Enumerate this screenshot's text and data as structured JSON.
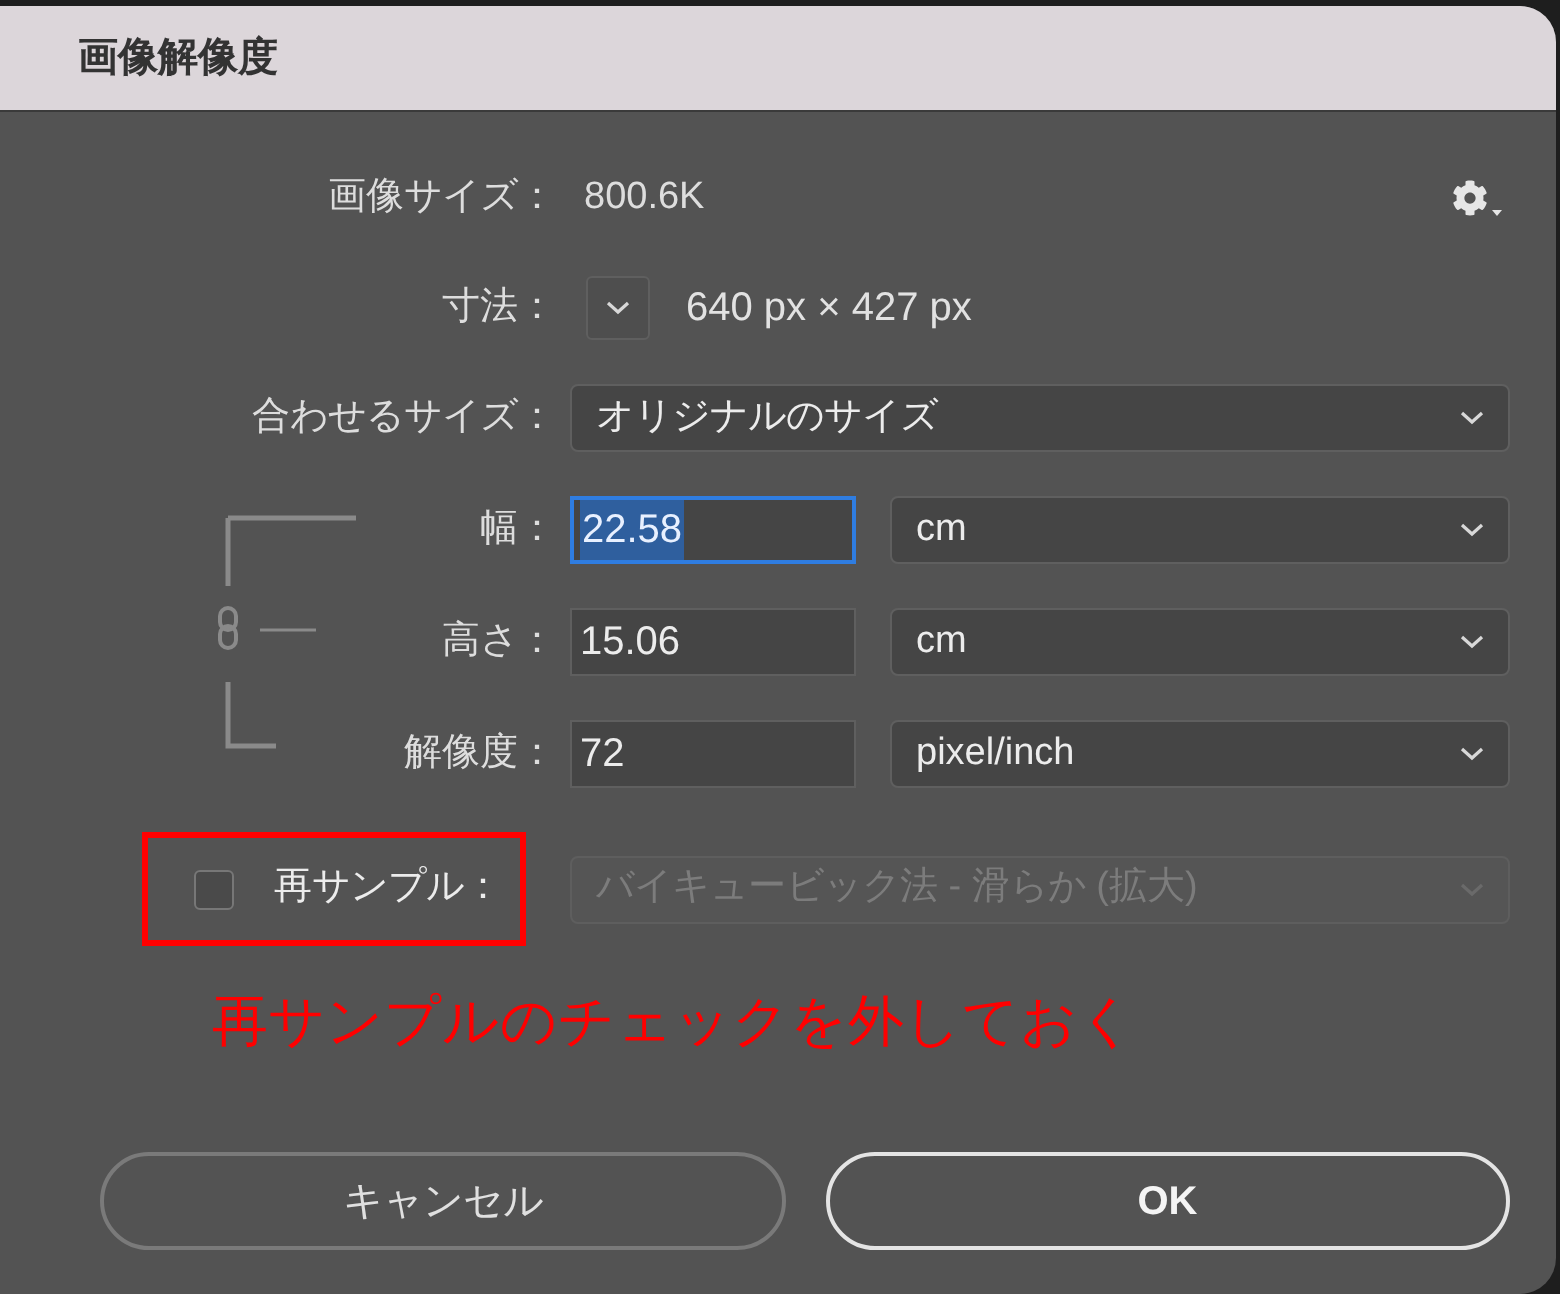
{
  "window": {
    "title": "画像解像度"
  },
  "image_size": {
    "label": "画像サイズ：",
    "value": "800.6K"
  },
  "dimensions": {
    "label": "寸法：",
    "value": "640 px × 427 px"
  },
  "fit_to": {
    "label": "合わせるサイズ：",
    "value": "オリジナルのサイズ"
  },
  "fields": [
    {
      "label": "幅：",
      "value": "22.58",
      "unit": "cm",
      "focused": true
    },
    {
      "label": "高さ：",
      "value": "15.06",
      "unit": "cm",
      "focused": false
    },
    {
      "label": "解像度：",
      "value": "72",
      "unit": "pixel/inch",
      "focused": false
    }
  ],
  "resample": {
    "label": "再サンプル：",
    "checked": false,
    "method": "バイキュービック法 - 滑らか (拡大)",
    "disabled": true,
    "highlighted": true
  },
  "annotation": {
    "text": "再サンプルのチェックを外しておく"
  },
  "buttons": [
    {
      "label": "キャンセル",
      "kind": "secondary"
    },
    {
      "label": "OK",
      "kind": "default"
    }
  ]
}
